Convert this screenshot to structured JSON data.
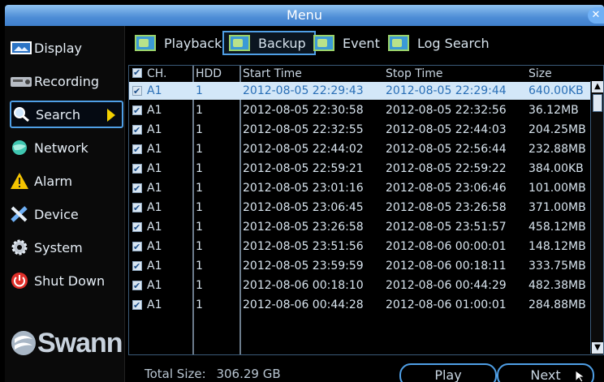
{
  "window": {
    "title": "Menu",
    "close_glyph": "✕"
  },
  "sidebar": {
    "items": [
      {
        "label": "Display",
        "icon": "monitor-icon"
      },
      {
        "label": "Recording",
        "icon": "recorder-icon"
      },
      {
        "label": "Search",
        "icon": "magnifier-icon",
        "active": true
      },
      {
        "label": "Network",
        "icon": "globe-icon"
      },
      {
        "label": "Alarm",
        "icon": "warning-icon"
      },
      {
        "label": "Device",
        "icon": "tools-icon"
      },
      {
        "label": "System",
        "icon": "gear-icon"
      },
      {
        "label": "Shut Down",
        "icon": "power-icon"
      }
    ],
    "logo": "Swann"
  },
  "tabs": [
    {
      "label": "Playback"
    },
    {
      "label": "Backup",
      "active": true
    },
    {
      "label": "Event"
    },
    {
      "label": "Log Search"
    }
  ],
  "table": {
    "headers": {
      "ch": "CH.",
      "hdd": "HDD",
      "start": "Start Time",
      "stop": "Stop Time",
      "size": "Size"
    },
    "rows": [
      {
        "ch": "A1",
        "hdd": "1",
        "start": "2012-08-05 22:29:43",
        "stop": "2012-08-05 22:29:44",
        "size": "640.00KB"
      },
      {
        "ch": "A1",
        "hdd": "1",
        "start": "2012-08-05 22:30:58",
        "stop": "2012-08-05 22:32:56",
        "size": "36.12MB"
      },
      {
        "ch": "A1",
        "hdd": "1",
        "start": "2012-08-05 22:32:55",
        "stop": "2012-08-05 22:44:03",
        "size": "204.25MB"
      },
      {
        "ch": "A1",
        "hdd": "1",
        "start": "2012-08-05 22:44:02",
        "stop": "2012-08-05 22:56:44",
        "size": "232.88MB"
      },
      {
        "ch": "A1",
        "hdd": "1",
        "start": "2012-08-05 22:59:21",
        "stop": "2012-08-05 22:59:22",
        "size": "384.00KB"
      },
      {
        "ch": "A1",
        "hdd": "1",
        "start": "2012-08-05 23:01:16",
        "stop": "2012-08-05 23:06:46",
        "size": "101.00MB"
      },
      {
        "ch": "A1",
        "hdd": "1",
        "start": "2012-08-05 23:06:45",
        "stop": "2012-08-05 23:26:58",
        "size": "371.00MB"
      },
      {
        "ch": "A1",
        "hdd": "1",
        "start": "2012-08-05 23:26:58",
        "stop": "2012-08-05 23:51:57",
        "size": "458.12MB"
      },
      {
        "ch": "A1",
        "hdd": "1",
        "start": "2012-08-05 23:51:56",
        "stop": "2012-08-06 00:00:01",
        "size": "148.12MB"
      },
      {
        "ch": "A1",
        "hdd": "1",
        "start": "2012-08-05 23:59:59",
        "stop": "2012-08-06 00:18:11",
        "size": "333.75MB"
      },
      {
        "ch": "A1",
        "hdd": "1",
        "start": "2012-08-06 00:18:10",
        "stop": "2012-08-06 00:44:29",
        "size": "482.38MB"
      },
      {
        "ch": "A1",
        "hdd": "1",
        "start": "2012-08-06 00:44:28",
        "stop": "2012-08-06 01:00:01",
        "size": "284.88MB"
      }
    ]
  },
  "footer": {
    "total_label": "Total Size:",
    "total_value": "306.29 GB",
    "play_label": "Play",
    "next_label": "Next"
  },
  "colors": {
    "accent": "#4f9fe6",
    "title_bar": "#4d8cd6",
    "selected_row": "#d3e7f8"
  }
}
